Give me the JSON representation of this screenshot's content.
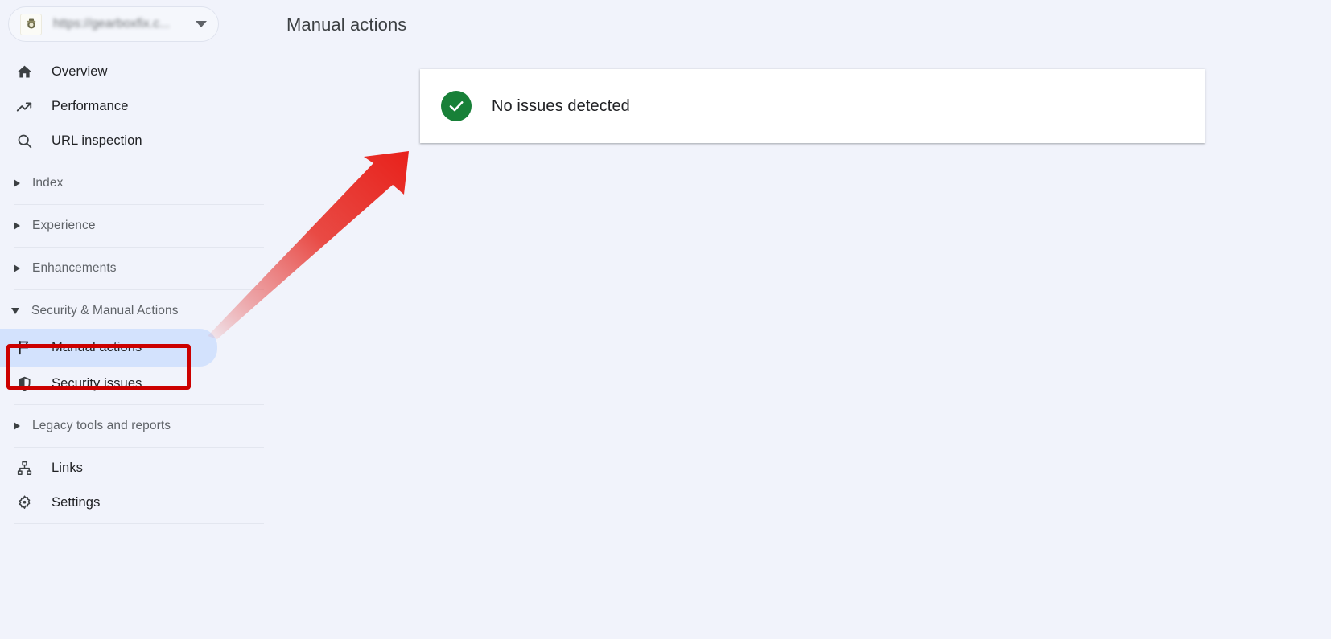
{
  "app": {
    "background_color": "#f1f3fb",
    "accent_selected_color": "#d3e2fd",
    "annotation_color": "#cc0000",
    "success_color": "#188038"
  },
  "sidebar": {
    "property_selector": {
      "name": "property-selector",
      "url": "https://gearboxfix.c...",
      "favicon_alt": "site-favicon",
      "caret": "chevron-down-icon"
    },
    "primary_items": [
      {
        "label": "Overview",
        "icon": "home-icon"
      },
      {
        "label": "Performance",
        "icon": "trending-up-icon"
      },
      {
        "label": "URL inspection",
        "icon": "search-icon"
      }
    ],
    "groups": [
      {
        "label": "Index",
        "expanded": false,
        "icon": "triangle-right-icon"
      },
      {
        "label": "Experience",
        "expanded": false,
        "icon": "triangle-right-icon"
      },
      {
        "label": "Enhancements",
        "expanded": false,
        "icon": "triangle-right-icon"
      }
    ],
    "security_group": {
      "label": "Security & Manual Actions",
      "expanded": true,
      "icon": "triangle-down-icon",
      "items": [
        {
          "label": "Manual actions",
          "icon": "flag-icon",
          "selected": true
        },
        {
          "label": "Security issues",
          "icon": "shield-icon",
          "selected": false
        }
      ]
    },
    "legacy_group": {
      "label": "Legacy tools and reports",
      "expanded": false,
      "icon": "triangle-right-icon"
    },
    "bottom_items": [
      {
        "label": "Links",
        "icon": "links-hierarchy-icon"
      },
      {
        "label": "Settings",
        "icon": "gear-icon"
      }
    ]
  },
  "main": {
    "page_title": "Manual actions",
    "status_card": {
      "icon": "check-circle-icon",
      "text": "No issues detected"
    }
  },
  "annotations": {
    "highlight_rect": {
      "name": "manual-actions-highlight-box",
      "target": "Manual actions"
    },
    "arrow": {
      "name": "pointer-arrow",
      "direction": "up-right",
      "target": "Manual actions"
    }
  }
}
